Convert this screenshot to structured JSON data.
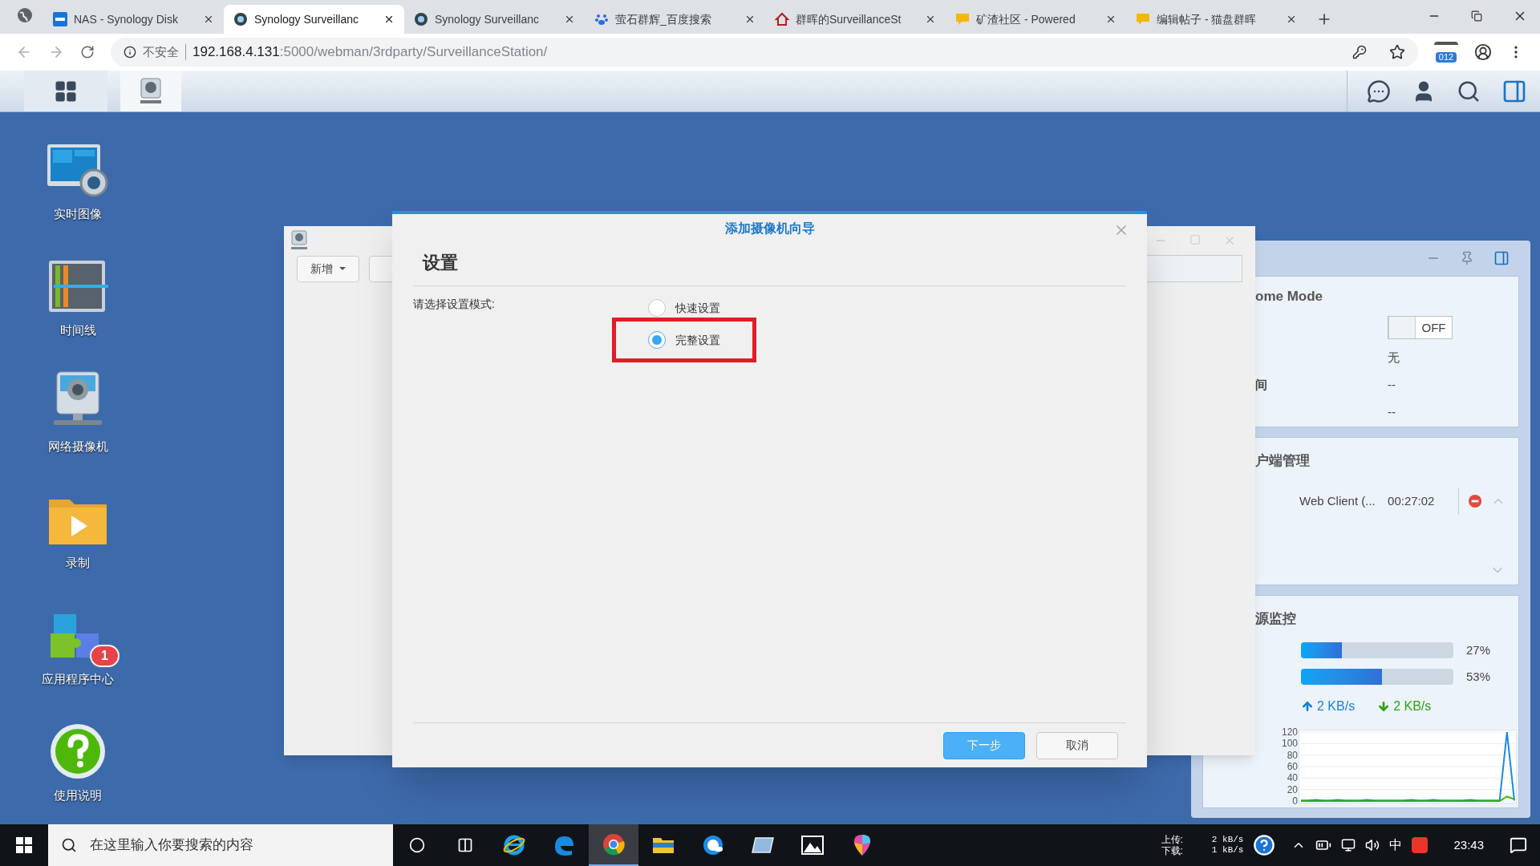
{
  "browser": {
    "tabs": [
      {
        "title": "NAS - Synology Disk",
        "kind": "dsm",
        "selected": false
      },
      {
        "title": "Synology Surveillanc",
        "kind": "surveillance",
        "selected": true
      },
      {
        "title": "Synology Surveillanc",
        "kind": "surveillance",
        "selected": false
      },
      {
        "title": "萤石群辉_百度搜索",
        "kind": "paw",
        "selected": false
      },
      {
        "title": "群晖的SurveillanceSt",
        "kind": "home",
        "selected": false
      },
      {
        "title": "矿渣社区 - Powered",
        "kind": "forum",
        "selected": false
      },
      {
        "title": "编辑帖子 - 猫盘群晖",
        "kind": "forum",
        "selected": false
      }
    ],
    "address": {
      "security": "不安全",
      "host": "192.168.4.131",
      "path": ":5000/webman/3rdparty/SurveillanceStation/"
    },
    "extension_badge": "012"
  },
  "desktop_icons": [
    {
      "label": "实时图像",
      "kind": "live_view"
    },
    {
      "label": "时间线",
      "kind": "timeline"
    },
    {
      "label": "网络摄像机",
      "kind": "ip_camera"
    },
    {
      "label": "录制",
      "kind": "recording"
    },
    {
      "label": "应用程序中心",
      "kind": "package_center",
      "badge": "1"
    },
    {
      "label": "使用说明",
      "kind": "help"
    }
  ],
  "background_window": {
    "add_button": "新增"
  },
  "dialog": {
    "title": "添加摄像机向导",
    "heading": "设置",
    "mode_label": "请选择设置模式:",
    "options": [
      {
        "label": "快速设置",
        "selected": false,
        "highlighted": false
      },
      {
        "label": "完整设置",
        "selected": true,
        "highlighted": true
      }
    ],
    "buttons": [
      {
        "label": "下一步",
        "kind": "primary"
      },
      {
        "label": "取消",
        "kind": "secondary"
      }
    ]
  },
  "widget": {
    "home_mode": {
      "title": "ome Mode",
      "switch": {
        "label": "OFF",
        "on": false
      },
      "rows": [
        {
          "value": "无"
        },
        {
          "label": "间",
          "value": "--"
        },
        {
          "value": "--"
        }
      ]
    },
    "clients": {
      "title": "户端管理",
      "rows": [
        {
          "name": "Web Client (...",
          "time": "00:27:02"
        }
      ]
    },
    "resources": {
      "title": "源监控",
      "meters": [
        {
          "level": 0.27,
          "reading": "27%"
        },
        {
          "level": 0.53,
          "reading": "53%"
        }
      ],
      "upload": "2 KB/s",
      "download": "2 KB/s",
      "chart_data": {
        "type": "line",
        "grid": true,
        "ylim": [
          0,
          120
        ],
        "yticks": [
          0,
          20,
          40,
          60,
          80,
          100,
          120
        ],
        "series": [
          {
            "color": "#1a8ae0",
            "values": [
              1,
              1,
              2,
              1,
              1,
              2,
              1,
              1,
              1,
              2,
              1,
              1,
              1,
              1,
              1,
              2,
              1,
              1,
              2,
              1,
              1,
              1,
              1,
              2,
              1,
              1,
              1,
              1,
              120,
              1
            ]
          },
          {
            "color": "#38b000",
            "values": [
              0,
              0,
              0,
              0,
              0,
              0,
              0,
              0,
              0,
              0,
              0,
              0,
              0,
              0,
              0,
              0,
              0,
              0,
              0,
              0,
              0,
              0,
              0,
              0,
              0,
              0,
              0,
              0,
              8,
              3
            ]
          }
        ]
      }
    }
  },
  "taskbar": {
    "search_placeholder": "在这里输入你要搜索的内容",
    "apps": [
      {
        "kind": "ie",
        "active": false
      },
      {
        "kind": "edge",
        "active": false
      },
      {
        "kind": "chrome",
        "active": true
      },
      {
        "kind": "explorer",
        "active": false
      },
      {
        "kind": "qq",
        "active": false
      },
      {
        "kind": "board",
        "active": false
      },
      {
        "kind": "photos",
        "active": false
      },
      {
        "kind": "paint",
        "active": false
      }
    ],
    "upload_label": "上传:",
    "download_label": "下载:",
    "upload_rate": "2 kB/s",
    "download_rate": "1 kB/s",
    "ime": "中",
    "time": "23:43"
  }
}
